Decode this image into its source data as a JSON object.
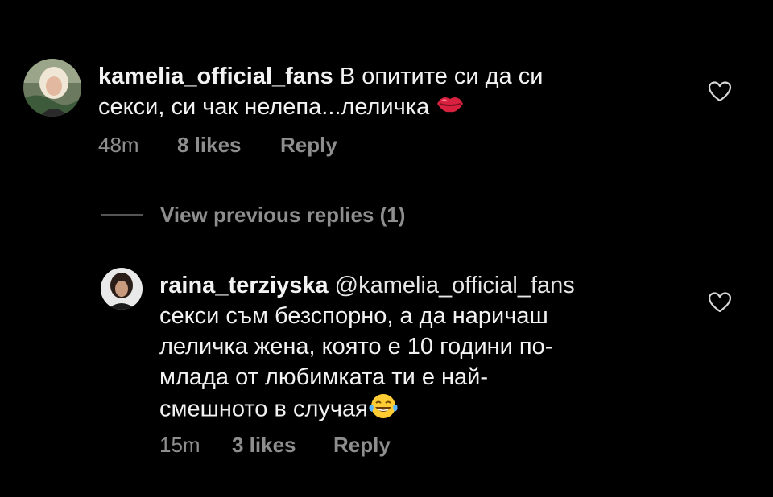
{
  "comments": [
    {
      "username": "kamelia_official_fans",
      "text_line1": "В опитите си да си",
      "text_line2": "секси, си чак нелепа...леличка",
      "emoji": "kiss-lips",
      "time": "48m",
      "likes": "8 likes",
      "reply": "Reply"
    }
  ],
  "view_previous": "View previous replies (1)",
  "replies": [
    {
      "username": "raina_terziyska",
      "mention": "@kamelia_official_fans",
      "lines": [
        "секси съм безспорно, а да наричаш",
        "леличка жена, която е 10 години по-",
        "млада от любимката ти е най-",
        "смешното в случая"
      ],
      "emoji": "tears-of-joy",
      "time": "15m",
      "likes": "3 likes",
      "reply": "Reply"
    }
  ],
  "icons": {
    "like": "heart-outline-icon"
  },
  "colors": {
    "background": "#000000",
    "text": "#f2f2f2",
    "secondary": "#8e8e8e"
  }
}
